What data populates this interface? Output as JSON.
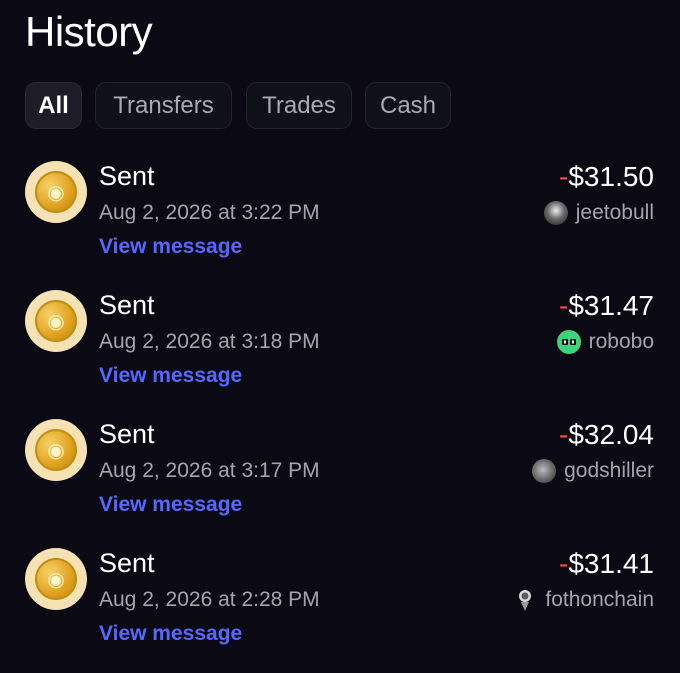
{
  "header": {
    "title": "History"
  },
  "tabs": [
    {
      "label": "All",
      "active": true
    },
    {
      "label": "Transfers",
      "active": false
    },
    {
      "label": "Trades",
      "active": false
    },
    {
      "label": "Cash",
      "active": false
    }
  ],
  "transactions": [
    {
      "type": "Sent",
      "date": "Aug 2, 2026 at 3:22 PM",
      "link": "View message",
      "sign": "-",
      "amount": "$31.50",
      "user": "jeetobull"
    },
    {
      "type": "Sent",
      "date": "Aug 2, 2026 at 3:18 PM",
      "link": "View message",
      "sign": "-",
      "amount": "$31.47",
      "user": "robobo"
    },
    {
      "type": "Sent",
      "date": "Aug 2, 2026 at 3:17 PM",
      "link": "View message",
      "sign": "-",
      "amount": "$32.04",
      "user": "godshiller"
    },
    {
      "type": "Sent",
      "date": "Aug 2, 2026 at 2:28 PM",
      "link": "View message",
      "sign": "-",
      "amount": "$31.41",
      "user": "fothonchain"
    }
  ],
  "colors": {
    "background": "#0b0a14",
    "negative": "#ff4b3e",
    "link": "#5468ff",
    "muted": "#a4a3ae"
  }
}
